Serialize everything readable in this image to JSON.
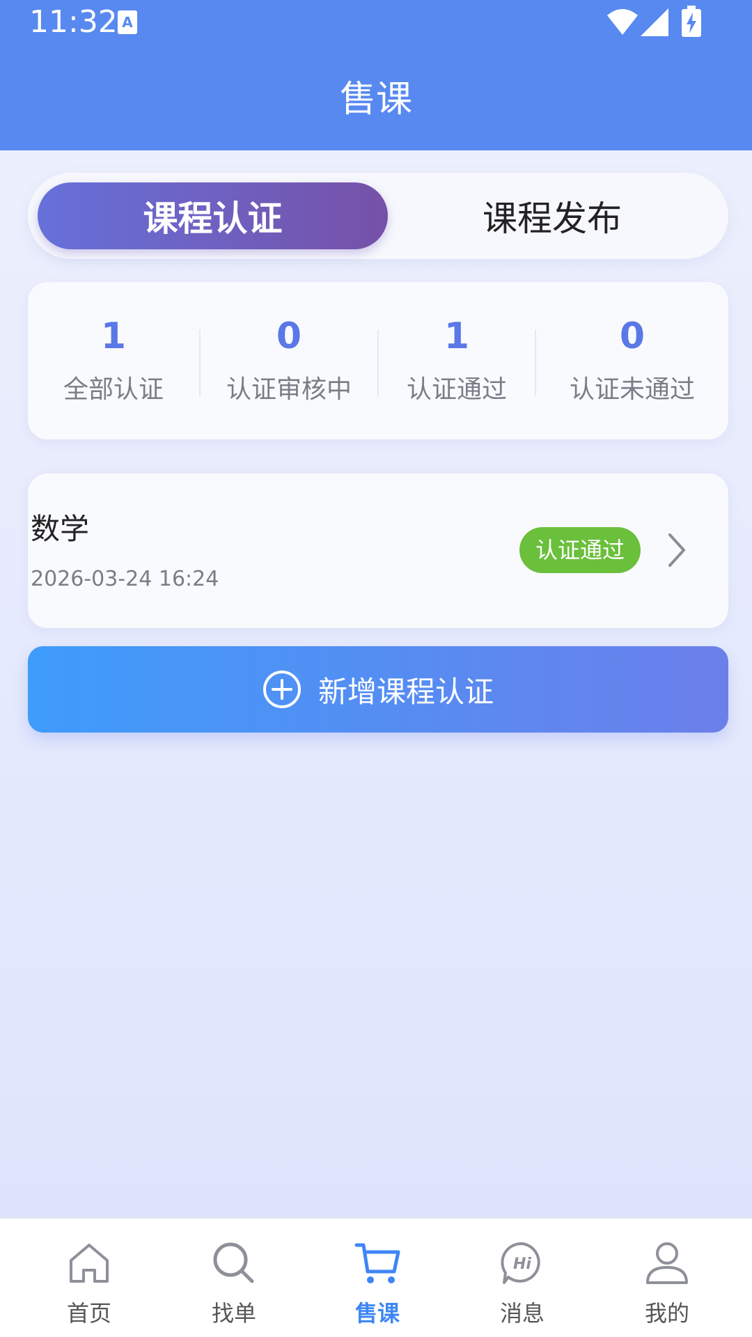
{
  "status_bar": {
    "time": "11:32"
  },
  "header": {
    "title": "售课"
  },
  "tabs": [
    {
      "label": "课程认证",
      "active": true
    },
    {
      "label": "课程发布",
      "active": false
    }
  ],
  "stats": [
    {
      "value": "1",
      "label": "全部认证"
    },
    {
      "value": "0",
      "label": "认证审核中"
    },
    {
      "value": "1",
      "label": "认证通过"
    },
    {
      "value": "0",
      "label": "认证未通过"
    }
  ],
  "records": [
    {
      "name": "数学",
      "date": "2026-03-24 16:24",
      "status": "认证通过"
    }
  ],
  "add_button": {
    "label": "新增课程认证"
  },
  "nav": [
    {
      "label": "首页",
      "icon": "home-icon",
      "active": false
    },
    {
      "label": "找单",
      "icon": "search-icon",
      "active": false
    },
    {
      "label": "售课",
      "icon": "cart-icon",
      "active": true
    },
    {
      "label": "消息",
      "icon": "message-hi-icon",
      "active": false
    },
    {
      "label": "我的",
      "icon": "user-icon",
      "active": false
    }
  ],
  "colors": {
    "header": "#5889F0",
    "accent": "#5A78E6",
    "badge": "#6ABF3B",
    "nav_active": "#3D86F5"
  }
}
